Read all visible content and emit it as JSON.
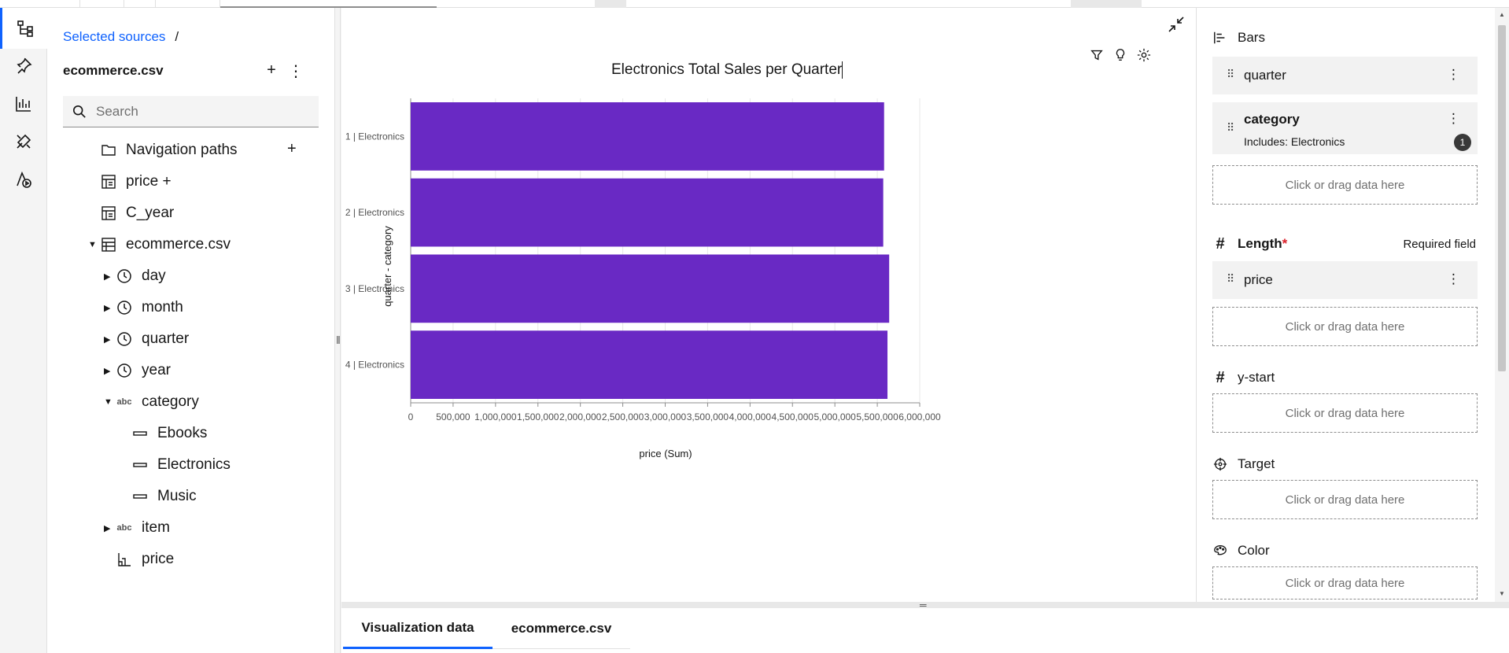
{
  "breadcrumb": {
    "link": "Selected sources",
    "separator": "/"
  },
  "source": {
    "title": "ecommerce.csv",
    "add_label": "+",
    "more_label": "⋮",
    "search_placeholder": "Search",
    "tree": [
      {
        "label": "Navigation paths",
        "icon": "folder-icon",
        "has_add": true
      },
      {
        "label": "price +",
        "icon": "table-calc-icon"
      },
      {
        "label": "C_year",
        "icon": "table-calc-icon"
      },
      {
        "label": "ecommerce.csv",
        "icon": "table-icon",
        "expanded": true
      },
      {
        "label": "day",
        "icon": "clock-icon",
        "collapsed": true
      },
      {
        "label": "month",
        "icon": "clock-icon",
        "collapsed": true
      },
      {
        "label": "quarter",
        "icon": "clock-icon",
        "collapsed": true
      },
      {
        "label": "year",
        "icon": "clock-icon",
        "collapsed": true
      },
      {
        "label": "category",
        "icon": "abc-icon",
        "icon_text": "abc",
        "expanded": true
      },
      {
        "label": "Ebooks",
        "icon": "member-icon"
      },
      {
        "label": "Electronics",
        "icon": "member-icon"
      },
      {
        "label": "Music",
        "icon": "member-icon"
      },
      {
        "label": "item",
        "icon": "abc-icon",
        "icon_text": "abc",
        "collapsed": true
      },
      {
        "label": "price",
        "icon": "measure-icon"
      }
    ]
  },
  "chart_data": {
    "type": "bar",
    "orientation": "horizontal",
    "title": "Electronics Total Sales per Quarter",
    "categories": [
      "1 | Electronics",
      "2 | Electronics",
      "3 | Electronics",
      "4 | Electronics"
    ],
    "values": [
      5580000,
      5570000,
      5640000,
      5620000
    ],
    "xlabel": "price (Sum)",
    "ylabel": "quarter - category",
    "xlim": [
      0,
      6000000
    ],
    "xticks": [
      "0",
      "500,000",
      "1,000,000",
      "1,500,000",
      "2,000,000",
      "2,500,000",
      "3,000,000",
      "3,500,000",
      "4,000,000",
      "4,500,000",
      "5,000,000",
      "5,500,000",
      "6,000,000"
    ],
    "bar_color": "#6929c4",
    "grid": true
  },
  "bottom_tabs": [
    "Visualization data",
    "ecommerce.csv"
  ],
  "props": {
    "bars_label": "Bars",
    "bars_fields": [
      {
        "name": "quarter"
      },
      {
        "name": "category",
        "sub": "Includes: Electronics",
        "badge": "1"
      }
    ],
    "length_label": "Length",
    "required_mark": "*",
    "required_note": "Required field",
    "length_field": "price",
    "ystart_label": "y-start",
    "target_label": "Target",
    "color_label": "Color",
    "drop_text": "Click or drag data here",
    "more_label": "⋮",
    "drag_label": "⠿"
  },
  "colors": {
    "accent": "#0f62fe",
    "bar": "#6929c4"
  }
}
